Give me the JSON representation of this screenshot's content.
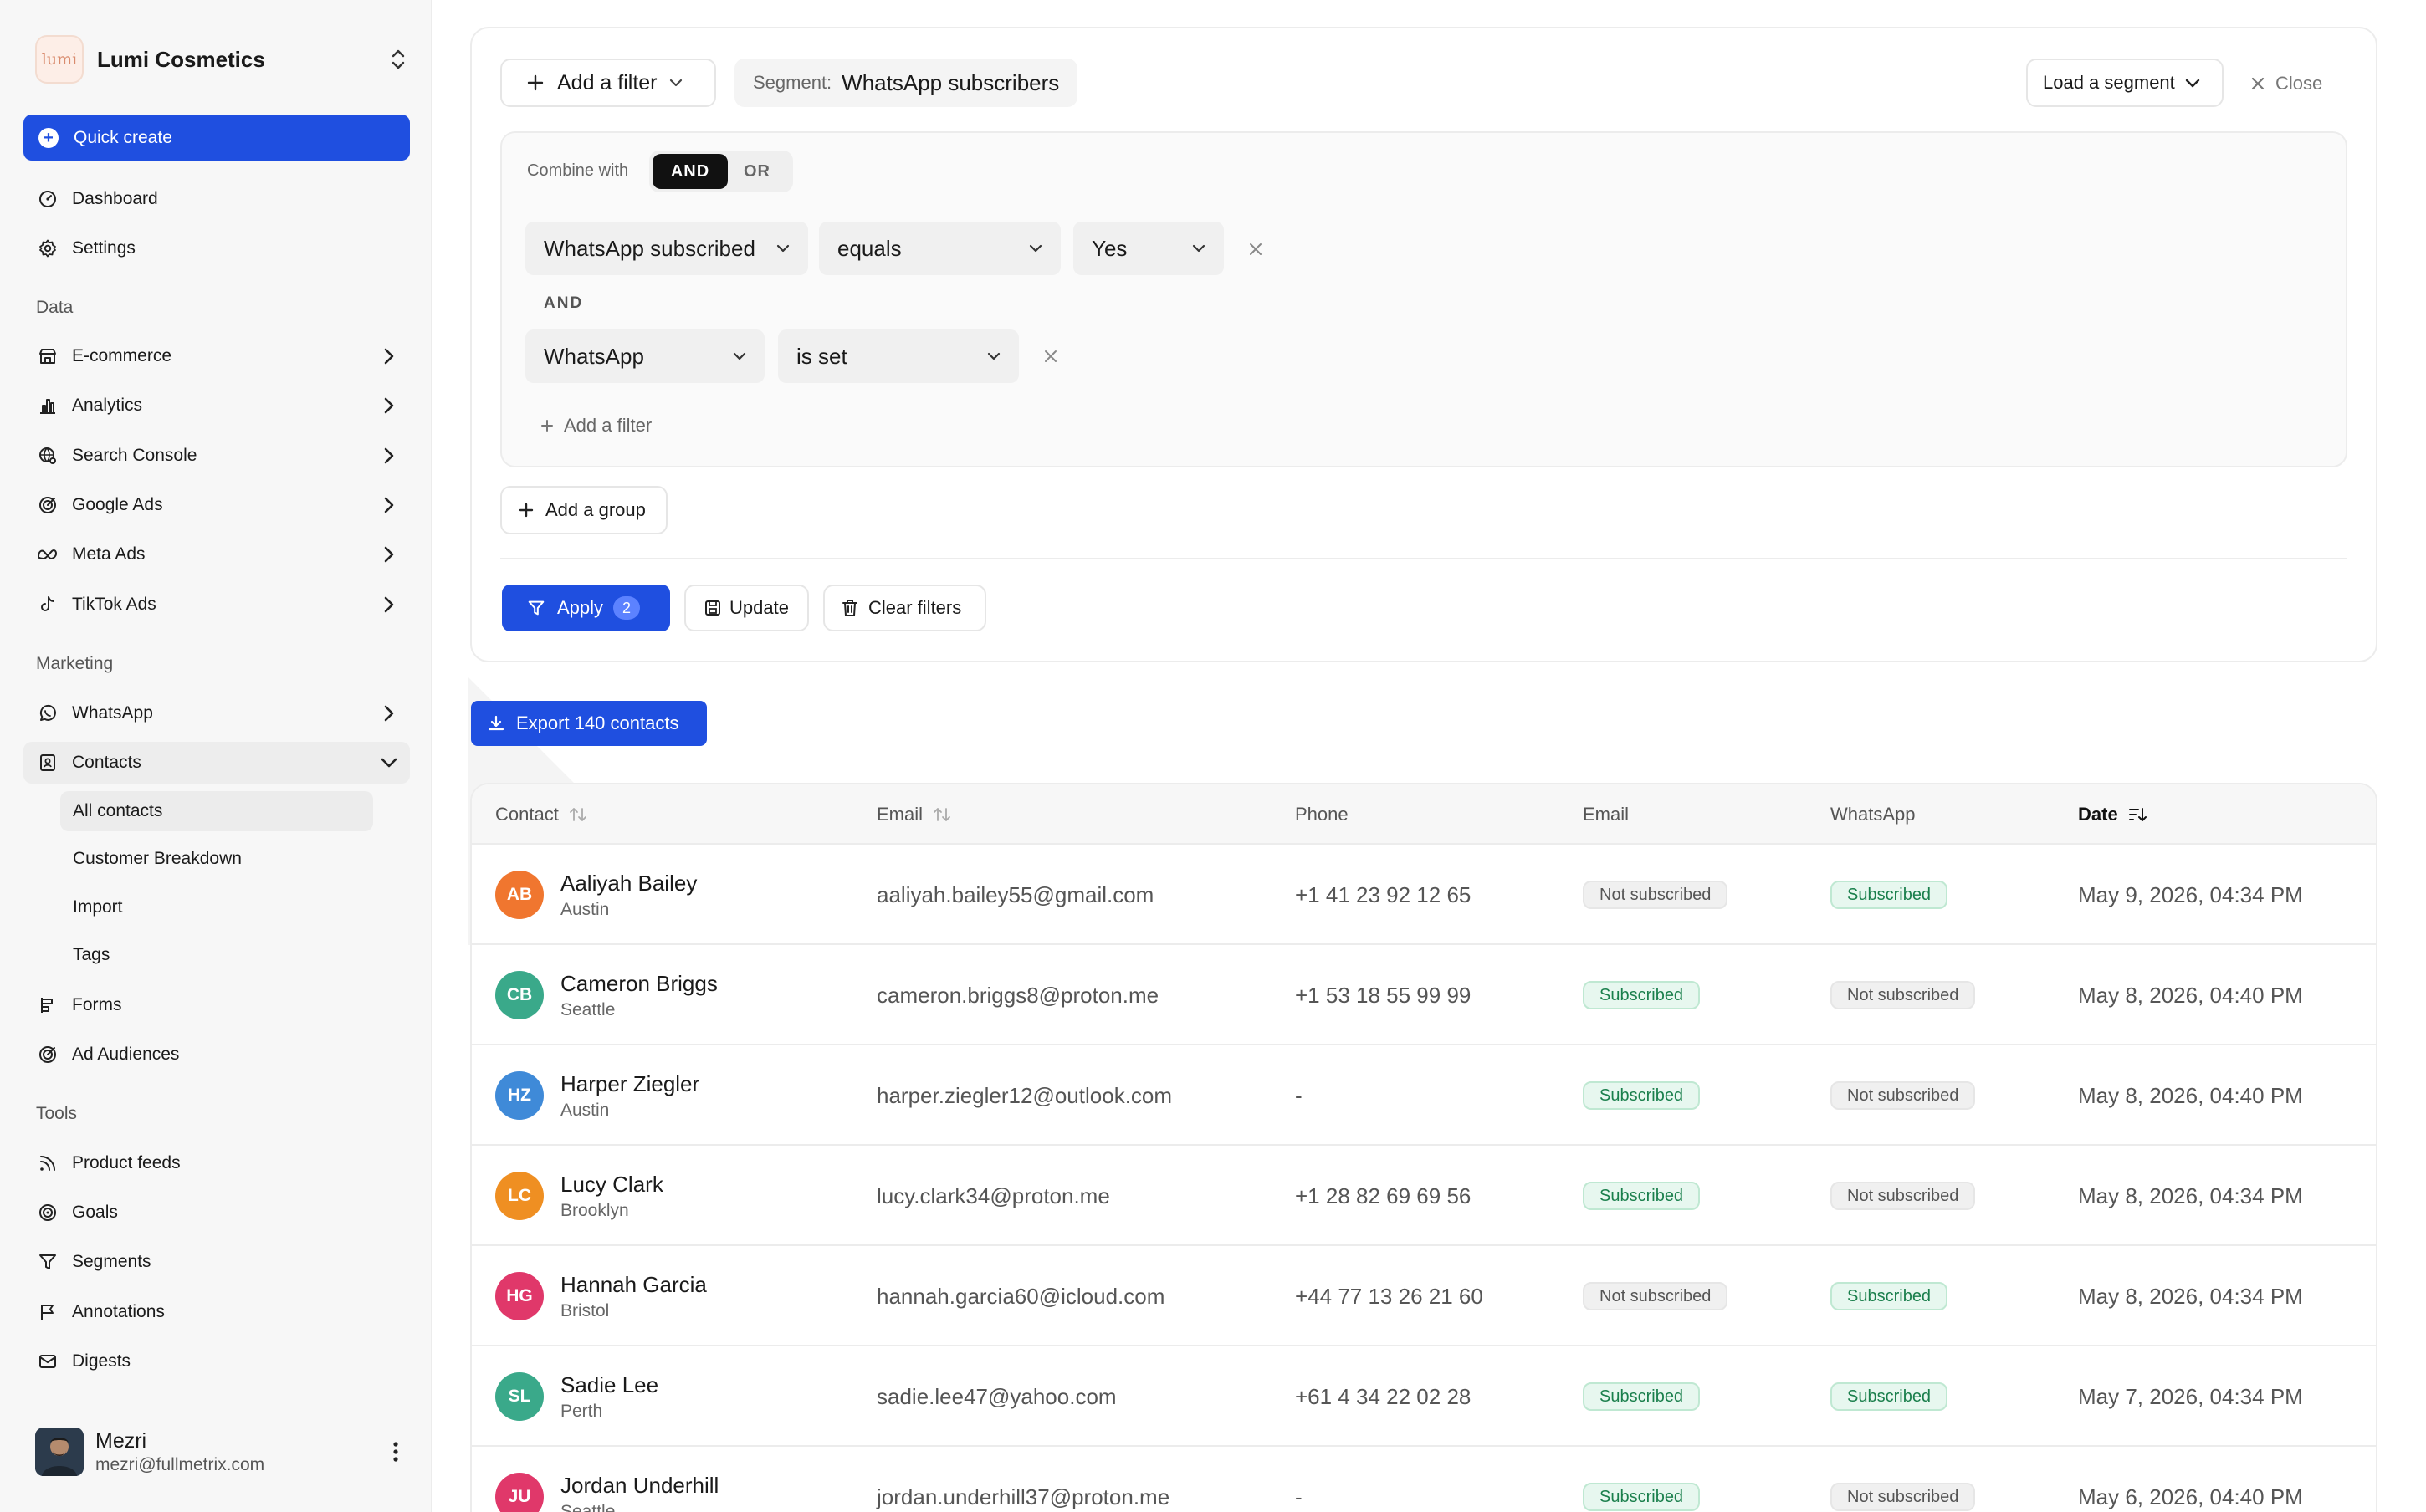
{
  "brand": {
    "logo_text": "lumi",
    "name": "Lumi Cosmetics"
  },
  "sidebar": {
    "quick_create": "Quick create",
    "top_items": [
      {
        "label": "Dashboard",
        "icon": "gauge-icon"
      },
      {
        "label": "Settings",
        "icon": "gear-icon"
      }
    ],
    "sections": {
      "data": "Data",
      "marketing": "Marketing",
      "tools": "Tools"
    },
    "data_items": [
      {
        "label": "E-commerce",
        "icon": "store-icon"
      },
      {
        "label": "Analytics",
        "icon": "bar-chart-icon"
      },
      {
        "label": "Search Console",
        "icon": "globe-search-icon"
      },
      {
        "label": "Google Ads",
        "icon": "target-icon"
      },
      {
        "label": "Meta Ads",
        "icon": "meta-icon"
      },
      {
        "label": "TikTok Ads",
        "icon": "tiktok-icon"
      }
    ],
    "marketing_items": [
      {
        "label": "WhatsApp",
        "icon": "whatsapp-icon"
      },
      {
        "label": "Contacts",
        "icon": "contacts-icon"
      }
    ],
    "contacts_sub": [
      "All contacts",
      "Customer Breakdown",
      "Import",
      "Tags"
    ],
    "marketing_more": [
      {
        "label": "Forms",
        "icon": "forms-icon"
      },
      {
        "label": "Ad Audiences",
        "icon": "audience-icon"
      }
    ],
    "tools_items": [
      {
        "label": "Product feeds",
        "icon": "rss-icon"
      },
      {
        "label": "Goals",
        "icon": "goal-icon"
      },
      {
        "label": "Segments",
        "icon": "funnel-icon"
      },
      {
        "label": "Annotations",
        "icon": "flag-icon"
      },
      {
        "label": "Digests",
        "icon": "mail-icon"
      }
    ],
    "user": {
      "name": "Mezri",
      "email": "mezri@fullmetrix.com"
    }
  },
  "filters": {
    "add_filter": "Add a filter",
    "segment_label": "Segment:",
    "segment_value": "WhatsApp subscribers",
    "load_segment": "Load a segment",
    "close": "Close",
    "combine_with": "Combine with",
    "combine_and": "AND",
    "combine_or": "OR",
    "rows": [
      {
        "field": "WhatsApp subscribed",
        "operator": "equals",
        "value": "Yes"
      },
      {
        "field": "WhatsApp",
        "operator": "is set"
      }
    ],
    "and_label": "AND",
    "add_filter_inner": "Add a filter",
    "add_group": "Add a group",
    "apply": "Apply",
    "apply_count": "2",
    "update": "Update",
    "clear": "Clear filters"
  },
  "export_label": "Export 140 contacts",
  "table": {
    "headers": {
      "contact": "Contact",
      "email": "Email",
      "phone": "Phone",
      "email_status": "Email",
      "whatsapp": "WhatsApp",
      "date": "Date"
    },
    "rows": [
      {
        "initials": "AB",
        "color": "#f0762f",
        "name": "Aaliyah Bailey",
        "city": "Austin",
        "email": "aaliyah.bailey55@gmail.com",
        "phone": "+1 41 23 92 12 65",
        "email_status": "Not subscribed",
        "whatsapp": "Subscribed",
        "date": "May 9, 2026, 04:34 PM"
      },
      {
        "initials": "CB",
        "color": "#3aa98a",
        "name": "Cameron Briggs",
        "city": "Seattle",
        "email": "cameron.briggs8@proton.me",
        "phone": "+1 53 18 55 99 99",
        "email_status": "Subscribed",
        "whatsapp": "Not subscribed",
        "date": "May 8, 2026, 04:40 PM"
      },
      {
        "initials": "HZ",
        "color": "#3f8ad8",
        "name": "Harper Ziegler",
        "city": "Austin",
        "email": "harper.ziegler12@outlook.com",
        "phone": "-",
        "email_status": "Subscribed",
        "whatsapp": "Not subscribed",
        "date": "May 8, 2026, 04:40 PM"
      },
      {
        "initials": "LC",
        "color": "#ef8f22",
        "name": "Lucy Clark",
        "city": "Brooklyn",
        "email": "lucy.clark34@proton.me",
        "phone": "+1 28 82 69 69 56",
        "email_status": "Subscribed",
        "whatsapp": "Not subscribed",
        "date": "May 8, 2026, 04:34 PM"
      },
      {
        "initials": "HG",
        "color": "#e0386a",
        "name": "Hannah Garcia",
        "city": "Bristol",
        "email": "hannah.garcia60@icloud.com",
        "phone": "+44 77 13 26 21 60",
        "email_status": "Not subscribed",
        "whatsapp": "Subscribed",
        "date": "May 8, 2026, 04:34 PM"
      },
      {
        "initials": "SL",
        "color": "#3aa98a",
        "name": "Sadie Lee",
        "city": "Perth",
        "email": "sadie.lee47@yahoo.com",
        "phone": "+61 4 34 22 02 28",
        "email_status": "Subscribed",
        "whatsapp": "Subscribed",
        "date": "May 7, 2026, 04:34 PM"
      },
      {
        "initials": "JU",
        "color": "#e0386a",
        "name": "Jordan Underhill",
        "city": "Seattle",
        "email": "jordan.underhill37@proton.me",
        "phone": "-",
        "email_status": "Subscribed",
        "whatsapp": "Not subscribed",
        "date": "May 6, 2026, 04:40 PM"
      }
    ]
  }
}
